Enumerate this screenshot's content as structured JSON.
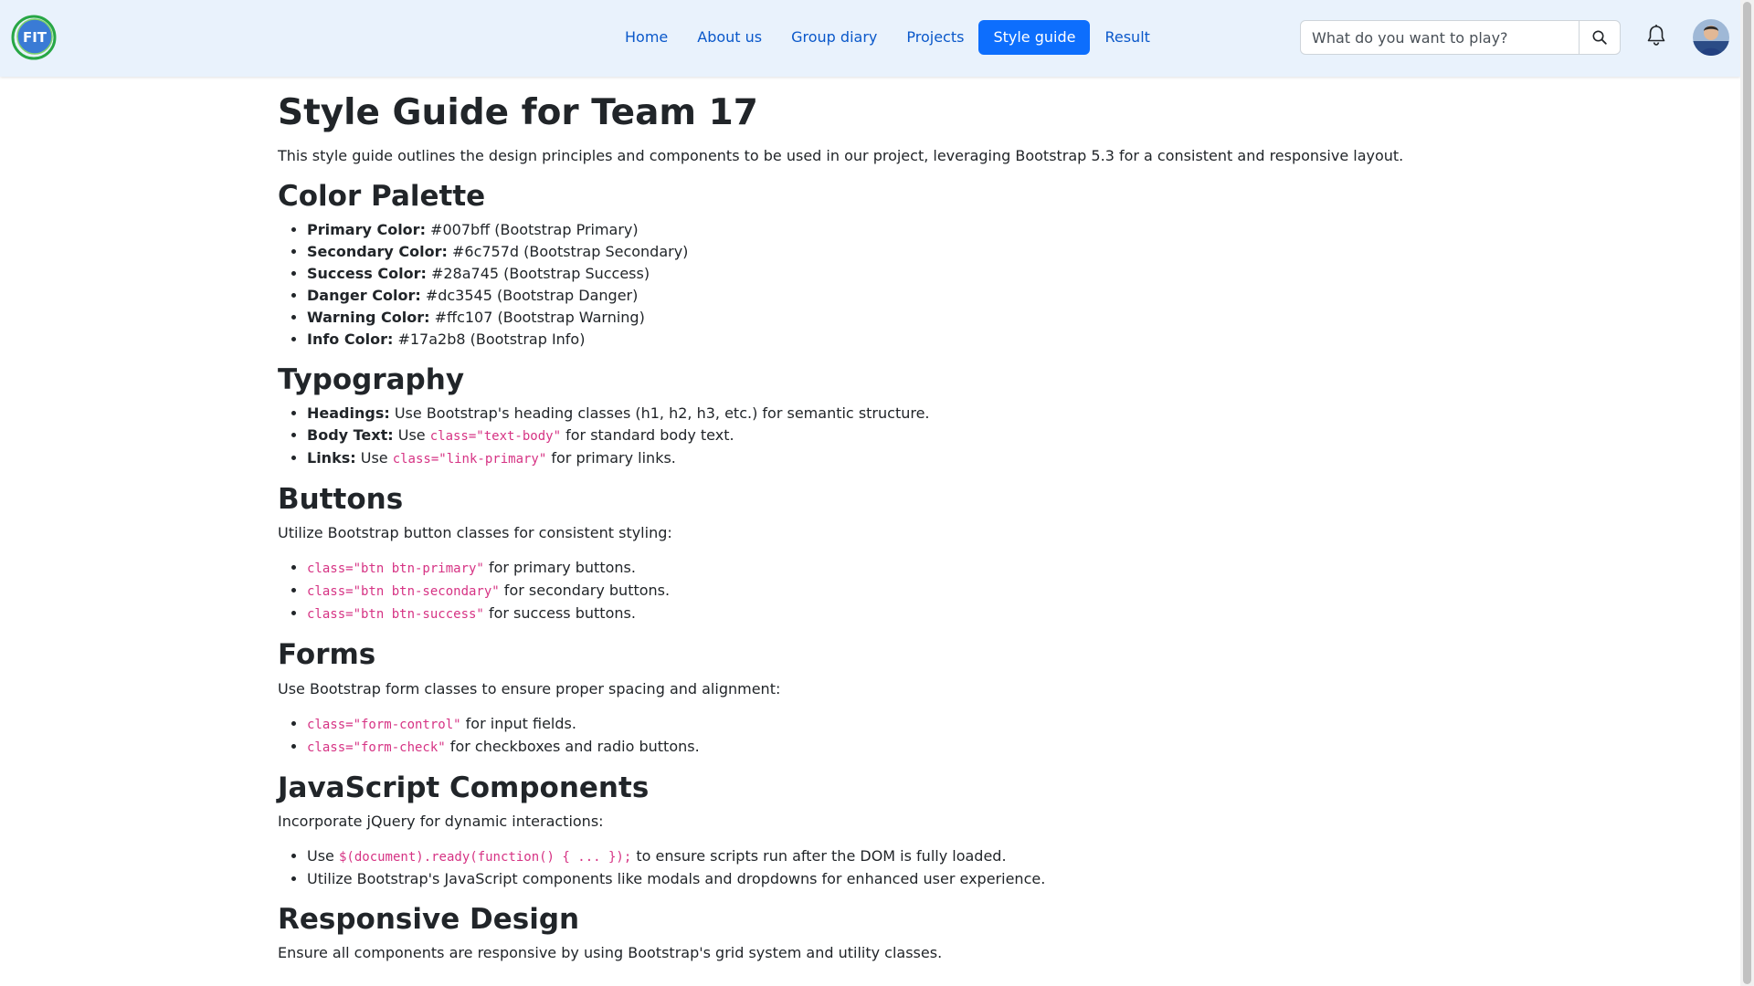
{
  "nav": {
    "items": [
      {
        "label": "Home",
        "active": false
      },
      {
        "label": "About us",
        "active": false
      },
      {
        "label": "Group diary",
        "active": false
      },
      {
        "label": "Projects",
        "active": false
      },
      {
        "label": "Style guide",
        "active": true
      },
      {
        "label": "Result",
        "active": false
      }
    ],
    "search_placeholder": "What do you want to play?",
    "logo_text": "FIT"
  },
  "page": {
    "title": "Style Guide for Team 17",
    "intro": "This style guide outlines the design principles and components to be used in our project, leveraging Bootstrap 5.3 for a consistent and responsive layout.",
    "color_palette": {
      "heading": "Color Palette",
      "items": [
        {
          "label": "Primary Color:",
          "text": " #007bff (Bootstrap Primary)"
        },
        {
          "label": "Secondary Color:",
          "text": " #6c757d (Bootstrap Secondary)"
        },
        {
          "label": "Success Color:",
          "text": " #28a745 (Bootstrap Success)"
        },
        {
          "label": "Danger Color:",
          "text": " #dc3545 (Bootstrap Danger)"
        },
        {
          "label": "Warning Color:",
          "text": " #ffc107 (Bootstrap Warning)"
        },
        {
          "label": "Info Color:",
          "text": " #17a2b8 (Bootstrap Info)"
        }
      ]
    },
    "typography": {
      "heading": "Typography",
      "items": [
        {
          "label": "Headings:",
          "pre": " Use Bootstrap's heading classes (h1, h2, h3, etc.) for semantic structure.",
          "code": "",
          "post": ""
        },
        {
          "label": "Body Text:",
          "pre": " Use ",
          "code": "class=\"text-body\"",
          "post": " for standard body text."
        },
        {
          "label": "Links:",
          "pre": " Use ",
          "code": "class=\"link-primary\"",
          "post": " for primary links."
        }
      ]
    },
    "buttons": {
      "heading": "Buttons",
      "intro": "Utilize Bootstrap button classes for consistent styling:",
      "items": [
        {
          "code": "class=\"btn btn-primary\"",
          "post": " for primary buttons."
        },
        {
          "code": "class=\"btn btn-secondary\"",
          "post": " for secondary buttons."
        },
        {
          "code": "class=\"btn btn-success\"",
          "post": " for success buttons."
        }
      ]
    },
    "forms": {
      "heading": "Forms",
      "intro": "Use Bootstrap form classes to ensure proper spacing and alignment:",
      "items": [
        {
          "code": "class=\"form-control\"",
          "post": " for input fields."
        },
        {
          "code": "class=\"form-check\"",
          "post": " for checkboxes and radio buttons."
        }
      ]
    },
    "javascript": {
      "heading": "JavaScript Components",
      "intro": "Incorporate jQuery for dynamic interactions:",
      "items": [
        {
          "pre": "Use ",
          "code": "$(document).ready(function() { ... });",
          "post": " to ensure scripts run after the DOM is fully loaded."
        },
        {
          "pre": "Utilize Bootstrap's JavaScript components like modals and dropdowns for enhanced user experience.",
          "code": "",
          "post": ""
        }
      ]
    },
    "responsive": {
      "heading": "Responsive Design",
      "intro": "Ensure all components are responsive by using Bootstrap's grid system and utility classes."
    }
  }
}
